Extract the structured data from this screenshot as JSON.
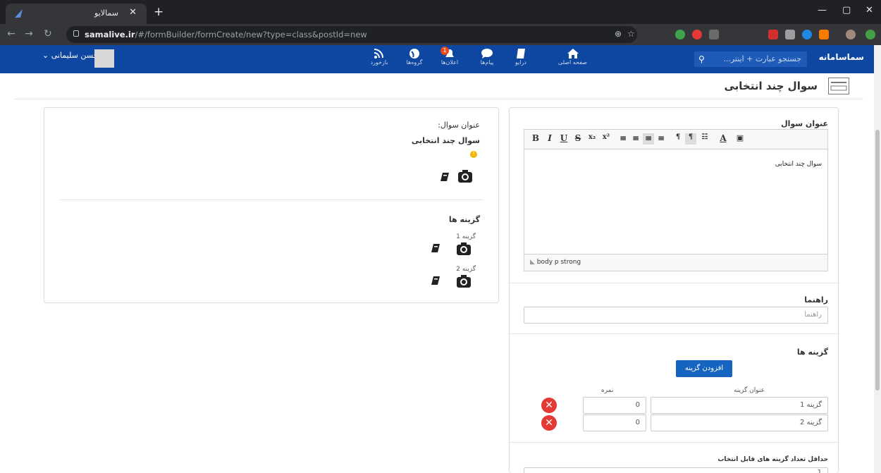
{
  "browser": {
    "tab_title": "سمالایو",
    "url_host": "samalive.ir",
    "url_path": "/#/formBuilder/formCreate/new?type=class&postId=new"
  },
  "sitenav": {
    "items": [
      {
        "label": "بازخورد",
        "icon": "rss-icon"
      },
      {
        "label": "گروه‌ها",
        "icon": "globe-icon"
      },
      {
        "label": "اعلان‌ها",
        "icon": "bell-icon",
        "badge": "1"
      },
      {
        "label": "پیام‌ها",
        "icon": "chat-icon"
      },
      {
        "label": "درایو",
        "icon": "book-icon"
      },
      {
        "label": "صفحه اصلی",
        "icon": "home-icon"
      }
    ],
    "search_placeholder": "جستجو عبارت + اینتر...",
    "logo": "سماسامانه",
    "user_name": "حسن سلیمانی"
  },
  "page": {
    "title": "سوال چند انتخابی"
  },
  "preview": {
    "question_title_label": "عنوان سوال:",
    "question_title_value": "سوال چند انتخابی",
    "options_heading": "گزینه ها",
    "options": [
      "گزینه 1",
      "گزینه 2"
    ]
  },
  "editor": {
    "question_title_label": "عنوان سوال",
    "content": "سوال چند انتخابی",
    "path": "body  p  strong",
    "guide_label": "راهنما",
    "guide_placeholder": "راهنما",
    "options_label": "گزینه ها",
    "add_option_button": "افزودن گزینه",
    "col_option_title": "عنوان گزینه",
    "col_score": "نمره",
    "option_rows": [
      {
        "title": "گزینه 1",
        "score": "0"
      },
      {
        "title": "گزینه 2",
        "score": "0"
      }
    ],
    "min_select_label": "حداقل تعداد گزینه های قابل انتخاب",
    "min_select_value": "1"
  }
}
